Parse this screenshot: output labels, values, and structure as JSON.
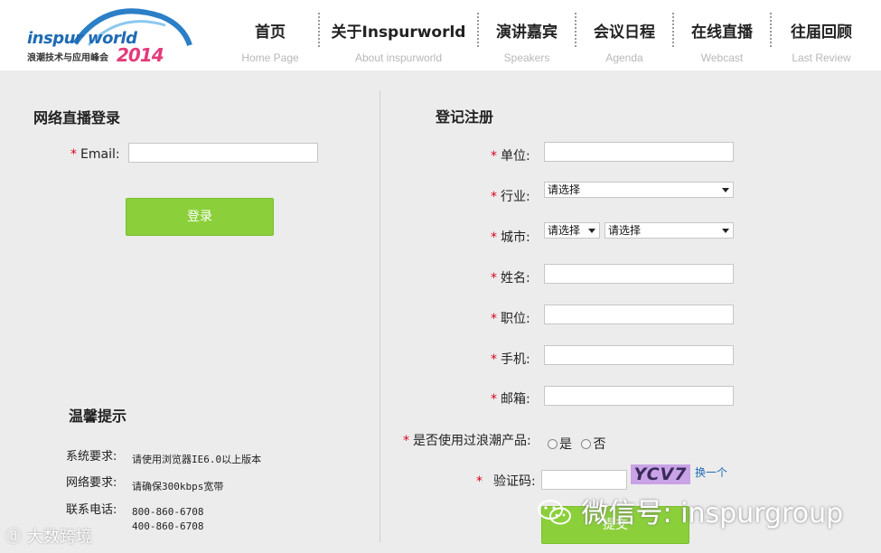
{
  "header": {
    "logo": {
      "word": "inspur world",
      "subtitle": "浪潮技术与应用峰会",
      "year": "2014"
    },
    "nav": [
      {
        "cn": "首页",
        "en": "Home Page"
      },
      {
        "cn": "关于Inspurworld",
        "en": "About inspurworld"
      },
      {
        "cn": "演讲嘉宾",
        "en": "Speakers"
      },
      {
        "cn": "会议日程",
        "en": "Agenda"
      },
      {
        "cn": "在线直播",
        "en": "Webcast"
      },
      {
        "cn": "往届回顾",
        "en": "Last Review"
      }
    ]
  },
  "login": {
    "title": "网络直播登录",
    "required_mark": "*",
    "email_label": "Email:",
    "email_value": "",
    "button": "登录"
  },
  "register": {
    "title": "登记注册",
    "required_mark": "*",
    "fields": {
      "company": "单位:",
      "industry": "行业:",
      "city": "城市:",
      "name": "姓名:",
      "position": "职位:",
      "phone": "手机:",
      "email": "邮箱:",
      "used_product": "是否使用过浪潮产品:",
      "captcha": "验证码:"
    },
    "industry_selected": "请选择",
    "province_selected": "请选择",
    "city_selected": "请选择",
    "radio_yes": "是",
    "radio_no": "否",
    "captcha_text": "YCV7",
    "refresh": "换一个",
    "submit": "提交"
  },
  "tips": {
    "title": "温馨提示",
    "system_label": "系统要求:",
    "system_value": "请使用浏览器IE6.0以上版本",
    "network_label": "网络要求:",
    "network_value": "请确保300kbps宽带",
    "contact_label": "联系电话:",
    "phone_1": "800-860-6708",
    "phone_2": "400-860-6708"
  },
  "watermarks": {
    "left": "大数跨境",
    "right": "微信号: inspurgroup"
  },
  "colors": {
    "accent_green": "#8bd03b",
    "brand_blue": "#1f6bb3",
    "required_red": "#d9001b",
    "year_pink": "#e43b7a"
  }
}
